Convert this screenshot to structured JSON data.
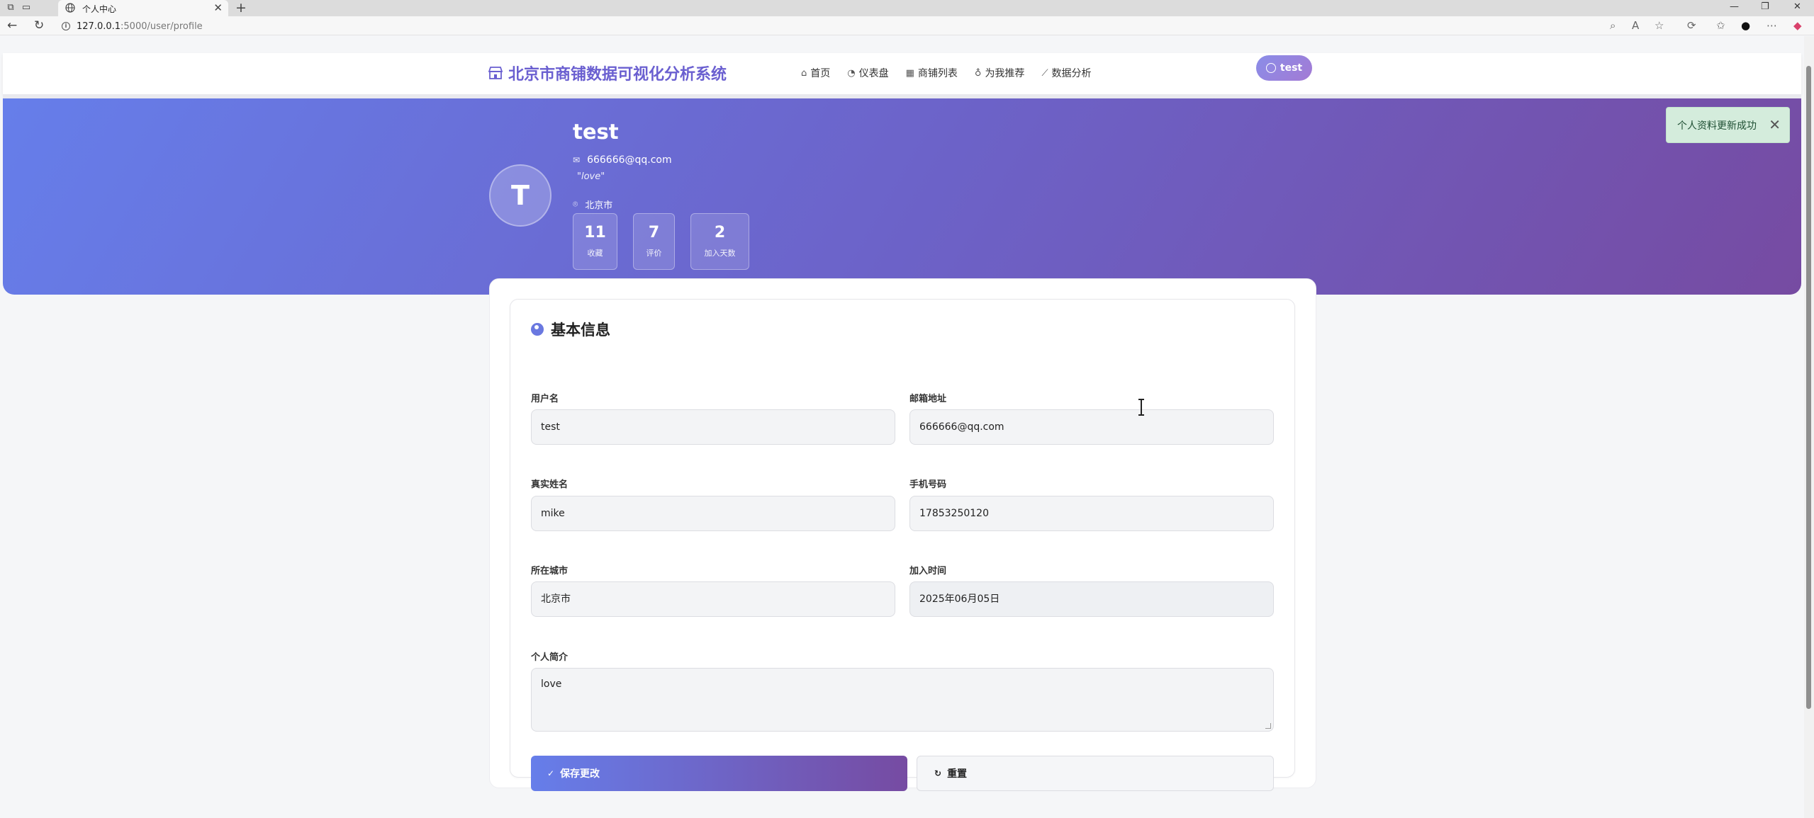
{
  "browser": {
    "tab_title": "个人中心",
    "url_host": "127.0.0.1",
    "url_path": ":5000/user/profile"
  },
  "navbar": {
    "brand": "北京市商铺数据可视化分析系统",
    "menu": [
      {
        "label": "首页",
        "icon": "home-icon"
      },
      {
        "label": "仪表盘",
        "icon": "dashboard-icon"
      },
      {
        "label": "商铺列表",
        "icon": "shop-icon"
      },
      {
        "label": "为我推荐",
        "icon": "lightbulb-icon"
      },
      {
        "label": "数据分析",
        "icon": "chart-icon"
      }
    ],
    "user": "test"
  },
  "profile": {
    "avatar_letter": "T",
    "name": "test",
    "email": "666666@qq.com",
    "bio": "\"love\"",
    "city": "北京市",
    "stats": [
      {
        "value": "11",
        "label": "收藏"
      },
      {
        "value": "7",
        "label": "评价"
      },
      {
        "value": "2",
        "label": "加入天数"
      }
    ]
  },
  "toast": {
    "message": "个人资料更新成功"
  },
  "form": {
    "title": "基本信息",
    "username": {
      "label": "用户名",
      "value": "test"
    },
    "email": {
      "label": "邮箱地址",
      "value": "666666@qq.com"
    },
    "realname": {
      "label": "真实姓名",
      "value": "mike"
    },
    "phone": {
      "label": "手机号码",
      "value": "17853250120"
    },
    "city": {
      "label": "所在城市",
      "value": "北京市"
    },
    "joined": {
      "label": "加入时间",
      "value": "2025年06月05日"
    },
    "bio": {
      "label": "个人简介",
      "value": "love"
    },
    "save_label": "保存更改",
    "reset_label": "重置"
  },
  "colors": {
    "gradient_start": "#667eea",
    "gradient_end": "#764ba2",
    "brand": "#6a5fd0",
    "toast_bg": "#d4ecdc"
  }
}
